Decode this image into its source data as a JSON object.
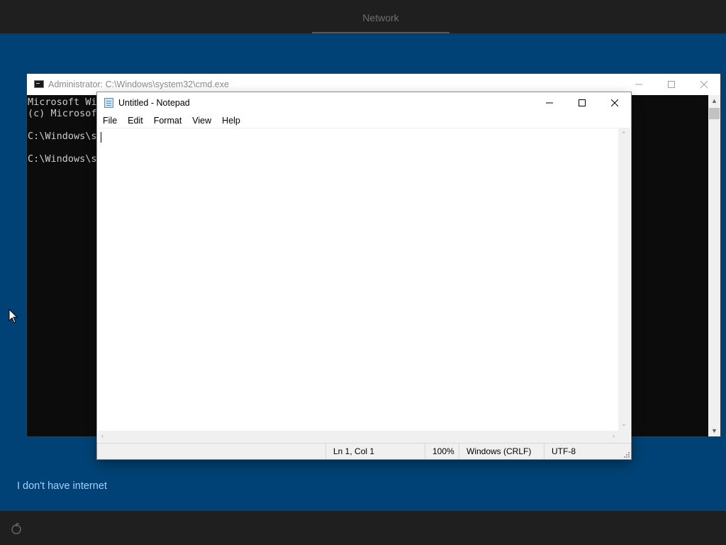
{
  "oobe": {
    "tab_network": "Network",
    "no_internet_link": "I don't have internet"
  },
  "cmd": {
    "title": "Administrator: C:\\Windows\\system32\\cmd.exe",
    "lines": [
      "Microsoft Wi",
      "(c) Microsof",
      "",
      "C:\\Windows\\sy",
      "",
      "C:\\Windows\\sy"
    ]
  },
  "notepad": {
    "title": "Untitled - Notepad",
    "menu": [
      "File",
      "Edit",
      "Format",
      "View",
      "Help"
    ],
    "content": "",
    "status": {
      "position": "Ln 1, Col 1",
      "zoom": "100%",
      "line_ending": "Windows (CRLF)",
      "encoding": "UTF-8"
    }
  },
  "icons": {
    "minimize": "minimize-icon",
    "maximize": "maximize-icon",
    "close": "close-icon",
    "accessibility": "accessibility-icon",
    "cursor": "mouse-cursor-icon"
  },
  "colors": {
    "oobe_background": "#004275",
    "oobe_bars": "#1f1f1f",
    "link": "#9fd3ff",
    "console_background": "#0c0c0c",
    "console_text": "#cccccc"
  }
}
